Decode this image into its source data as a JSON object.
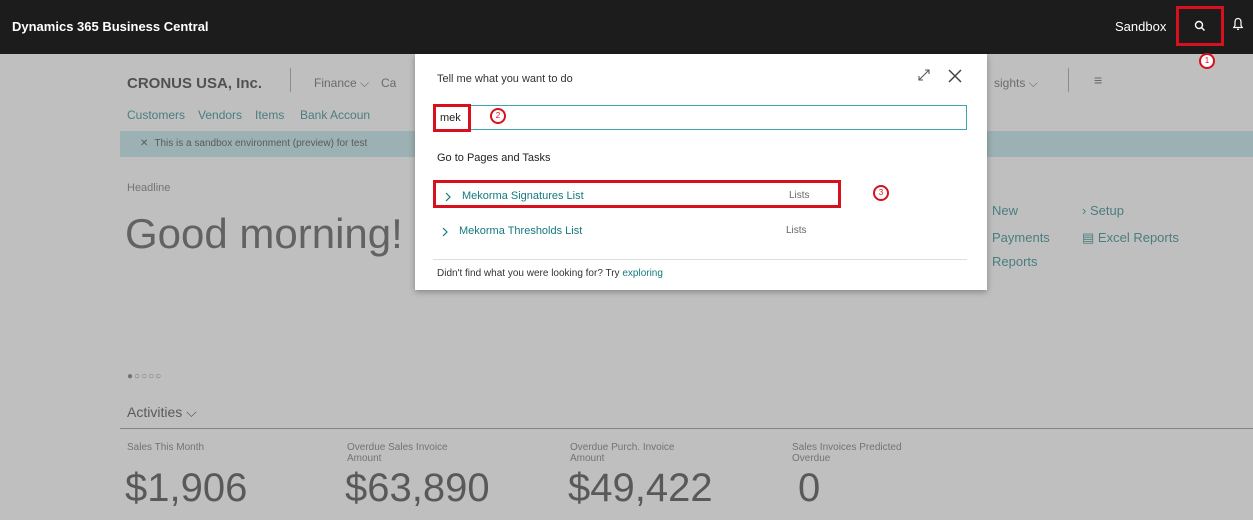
{
  "topbar": {
    "app_title": "Dynamics 365 Business Central",
    "environment": "Sandbox"
  },
  "page": {
    "company": "CRONUS USA, Inc.",
    "menus": [
      "Finance",
      "Ca",
      "sights"
    ],
    "nav_links": [
      "Customers",
      "Vendors",
      "Items",
      "Bank Accoun"
    ],
    "banner": "This is a sandbox environment (preview) for test",
    "headline_label": "Headline",
    "greeting": "Good morning!",
    "actions": [
      "New",
      "Payments",
      "Reports",
      "Setup",
      "Excel Reports"
    ],
    "activities_title": "Activities",
    "tiles": [
      {
        "label": "Sales This Month",
        "value": "$1,906"
      },
      {
        "label": "Overdue Sales Invoice Amount",
        "value": "$63,890"
      },
      {
        "label": "Overdue Purch. Invoice Amount",
        "value": "$49,422"
      },
      {
        "label": "Sales Invoices Predicted Overdue",
        "value": "0"
      }
    ]
  },
  "dialog": {
    "title": "Tell me what you want to do",
    "search_value": "mek",
    "section_title": "Go to Pages and Tasks",
    "results": [
      {
        "name": "Mekorma Signatures List",
        "category": "Lists"
      },
      {
        "name": "Mekorma Thresholds List",
        "category": "Lists"
      }
    ],
    "footer_text": "Didn't find what you were looking for? Try",
    "footer_link": "exploring"
  },
  "callouts": [
    "1",
    "2",
    "3"
  ],
  "colors": {
    "topbar": "#1c1c1c",
    "accent": "#137a7f",
    "highlight": "#d8101e",
    "banner": "#b9e3e8"
  }
}
